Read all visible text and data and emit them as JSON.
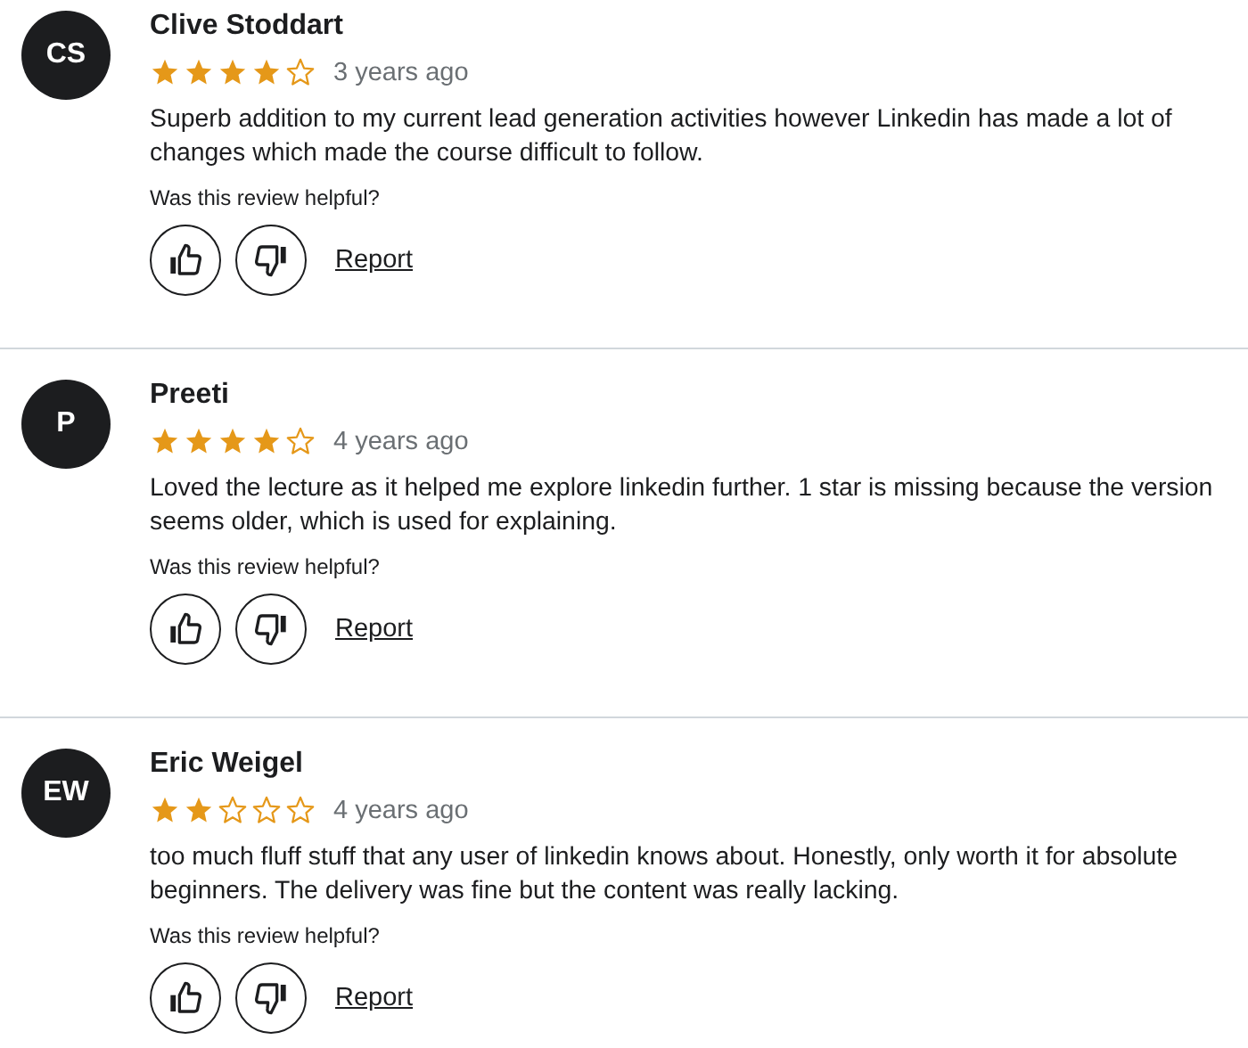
{
  "reviews": [
    {
      "initials": "CS",
      "name": "Clive Stoddart",
      "stars": 4,
      "time": "3 years ago",
      "text": "Superb addition to my current lead generation activities however Linkedin has made a lot of changes which made the course difficult to follow.",
      "helpful_prompt": "Was this review helpful?",
      "report": "Report"
    },
    {
      "initials": "P",
      "name": "Preeti",
      "stars": 4,
      "time": "4 years ago",
      "text": "Loved the lecture as it helped me explore linkedin further. 1 star is missing because the version seems older, which is used for explaining.",
      "helpful_prompt": "Was this review helpful?",
      "report": "Report"
    },
    {
      "initials": "EW",
      "name": "Eric Weigel",
      "stars": 2,
      "time": "4 years ago",
      "text": "too much fluff stuff that any user of linkedin knows about. Honestly, only worth it for absolute beginners. The delivery was fine but the content was really lacking.",
      "helpful_prompt": "Was this review helpful?",
      "report": "Report"
    }
  ]
}
